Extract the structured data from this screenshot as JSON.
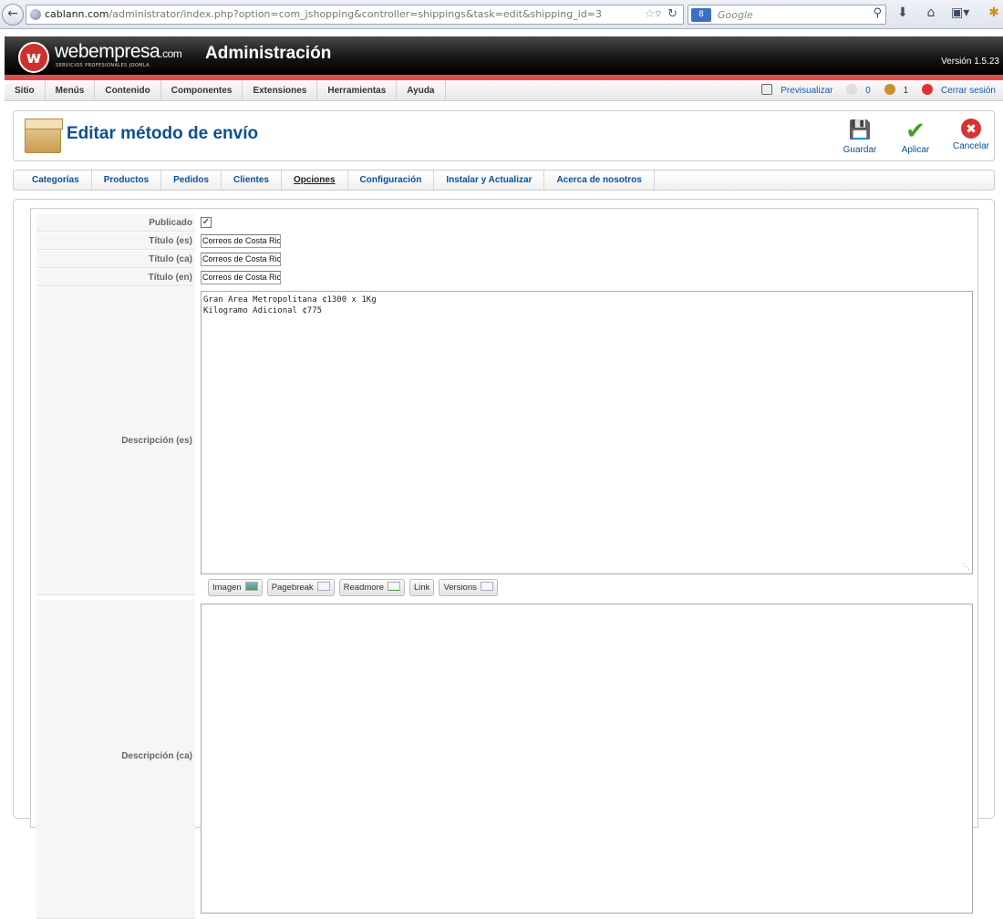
{
  "browser": {
    "back_icon": "back-arrow-icon",
    "url_domain": "cablann.com",
    "url_path": "/administrator/index.php?option=com_jshopping&controller=shippings&task=edit&shipping_id=3",
    "search_placeholder": "Google",
    "search_engine_label": "8"
  },
  "header": {
    "logo_text": "webempresa",
    "logo_suffix": ".com",
    "logo_subtitle": "SERVICIOS PROFESIONALES JOOMLA",
    "title": "Administración",
    "version": "Versión 1.5.23",
    "accent_color": "#e04d4d"
  },
  "menu": {
    "items": [
      "Sitio",
      "Menús",
      "Contenido",
      "Componentes",
      "Extensiones",
      "Herramientas",
      "Ayuda"
    ],
    "preview": "Previsualizar",
    "messages_count": "0",
    "users_count": "1",
    "logout": "Cerrar sesión"
  },
  "toolbar": {
    "page_title": "Editar método de envío",
    "save": "Guardar",
    "apply": "Aplicar",
    "cancel": "Cancelar"
  },
  "tabs": {
    "items": [
      "Categorías",
      "Productos",
      "Pedidos",
      "Clientes",
      "Opciones",
      "Configuración",
      "Instalar y Actualizar",
      "Acerca de nosotros"
    ],
    "active": "Opciones"
  },
  "form": {
    "published_label": "Publicado",
    "published_checked": true,
    "title_es_label": "Título (es)",
    "title_es_value": "Correos de Costa Rica",
    "title_ca_label": "Título (ca)",
    "title_ca_value": "Correos de Costa Rica",
    "title_en_label": "Título (en)",
    "title_en_value": "Correos de Costa Rica",
    "desc_es_label": "Descripción (es)",
    "desc_es_value": "Gran Area Metropolitana ¢1300 x 1Kg\nKilogramo Adicional ¢775",
    "desc_ca_label": "Descripción (ca)",
    "desc_ca_value": "",
    "editor_buttons": [
      "Imagen",
      "Pagebreak",
      "Readmore",
      "Link",
      "Versions"
    ]
  }
}
